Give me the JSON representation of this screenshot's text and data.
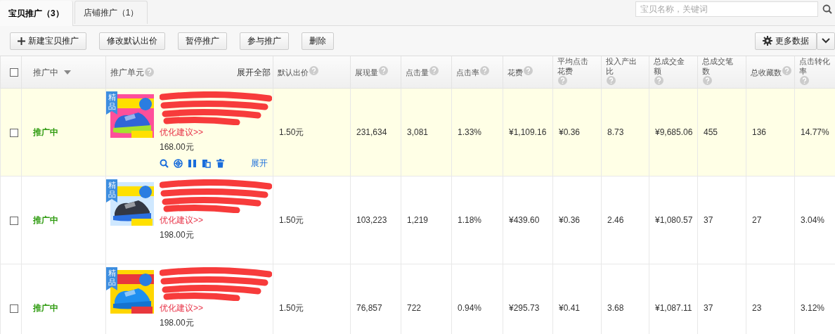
{
  "tabs": [
    {
      "label": "宝贝推广（3）",
      "selected": true
    },
    {
      "label": "店铺推广（1）",
      "selected": false
    }
  ],
  "search": {
    "placeholder": "宝贝名称，关键词"
  },
  "toolbar": [
    {
      "label": "新建宝贝推广",
      "kind": "add"
    },
    {
      "label": "修改默认出价",
      "kind": "plain"
    },
    {
      "label": "暂停推广",
      "kind": "plain"
    },
    {
      "label": "参与推广",
      "kind": "plain"
    },
    {
      "label": "删除",
      "kind": "plain"
    }
  ],
  "more_data": {
    "label": "更多数据"
  },
  "table": {
    "select_all": {
      "checked": false
    },
    "status_column": {
      "label": "推广中"
    },
    "unit_column": {
      "label": "推广单元",
      "link": "展开全部"
    },
    "columns": [
      {
        "label": "默认出价",
        "help": true
      },
      {
        "label": "展现量",
        "help": true
      },
      {
        "label": "点击量",
        "help": true
      },
      {
        "label": "点击率",
        "help": true
      },
      {
        "label": "花费",
        "help": true
      },
      {
        "label": "平均点击花费",
        "help": true
      },
      {
        "label": "投入产出比",
        "help": true
      },
      {
        "label": "总成交金额",
        "help": true
      },
      {
        "label": "总成交笔数",
        "help": true
      },
      {
        "label": "总收藏数",
        "help": true
      },
      {
        "label": "点击转化率",
        "help": true
      }
    ],
    "rows": [
      {
        "checked": false,
        "selected": true,
        "status": "推广中",
        "badge": "精品",
        "title_redacted": true,
        "suggestion": "优化建议>>",
        "price": "168.00元",
        "show_actions": true,
        "expand_link": "展开",
        "cells": [
          "1.50元",
          "231,634",
          "3,081",
          "1.33%",
          "¥1,109.16",
          "¥0.36",
          "8.73",
          "¥9,685.06",
          "455",
          "136",
          "14.77%"
        ]
      },
      {
        "checked": false,
        "selected": false,
        "status": "推广中",
        "badge": "精品",
        "title_redacted": true,
        "suggestion": "优化建议>>",
        "price": "198.00元",
        "show_actions": false,
        "cells": [
          "1.50元",
          "103,223",
          "1,219",
          "1.18%",
          "¥439.60",
          "¥0.36",
          "2.46",
          "¥1,080.57",
          "37",
          "27",
          "3.04%"
        ]
      },
      {
        "checked": false,
        "selected": false,
        "status": "推广中",
        "badge": "精品",
        "title_redacted": true,
        "suggestion": "优化建议>>",
        "price": "198.00元",
        "show_actions": false,
        "cells": [
          "1.50元",
          "76,857",
          "722",
          "0.94%",
          "¥295.73",
          "¥0.41",
          "3.68",
          "¥1,087.11",
          "37",
          "23",
          "3.12%"
        ]
      }
    ]
  }
}
